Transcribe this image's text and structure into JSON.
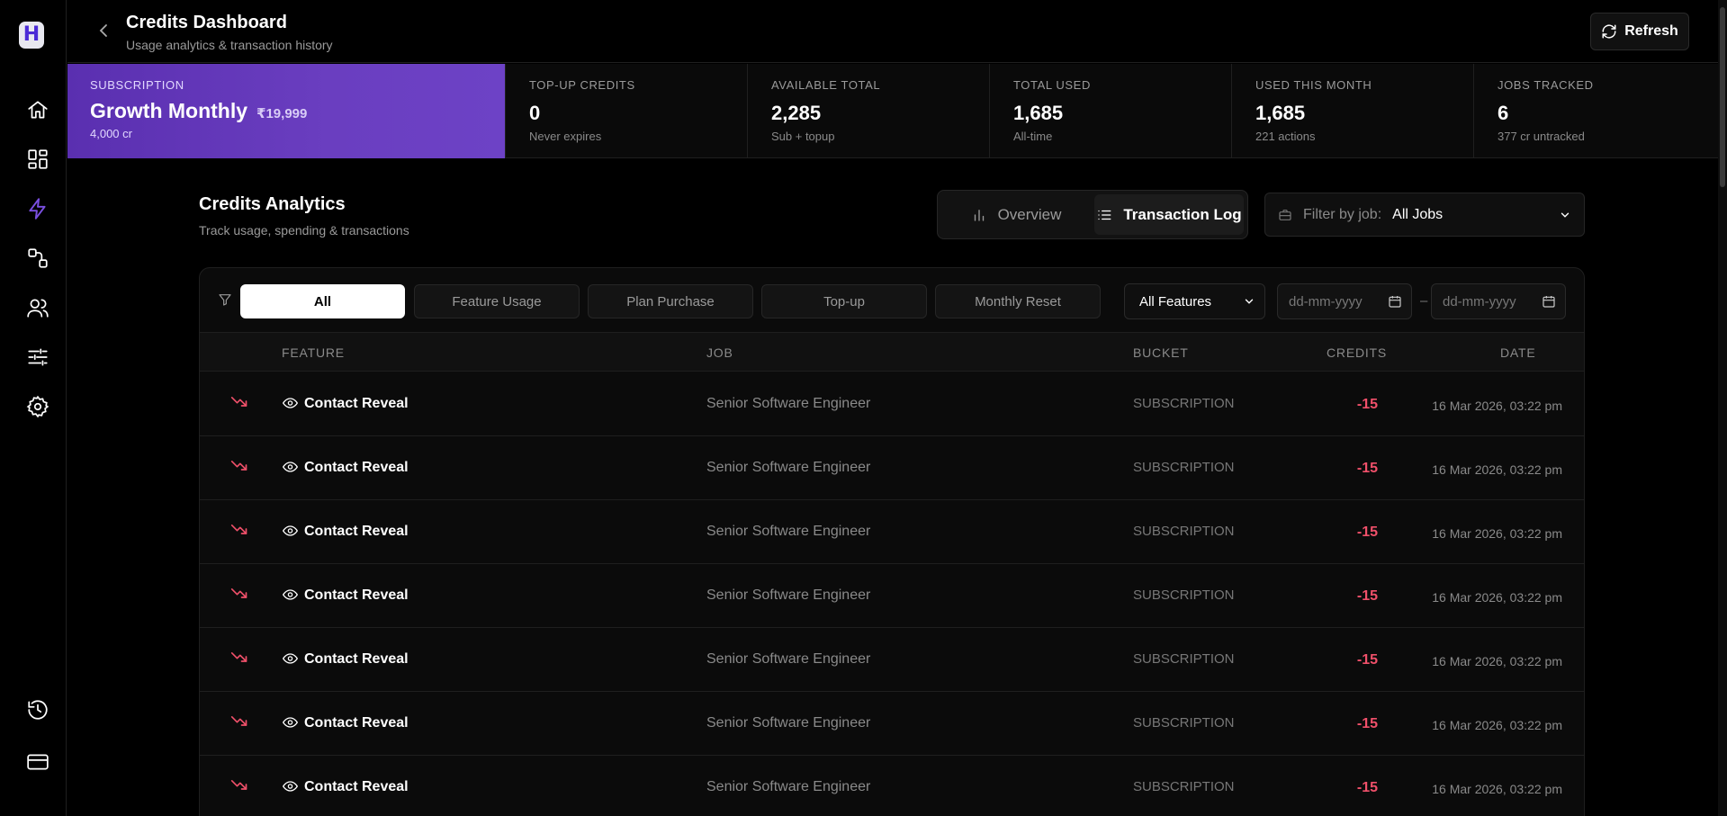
{
  "sidebar": {
    "logo_letter": "H",
    "accent": "#6d42c6",
    "icons": [
      "home-icon",
      "dashboard-icon",
      "credits-bolt-icon",
      "workflow-icon",
      "users-icon",
      "sliders-icon",
      "settings-icon",
      "history-icon",
      "billing-card-icon"
    ],
    "active": "credits-bolt-icon"
  },
  "header": {
    "title": "Credits Dashboard",
    "subtitle": "Usage analytics & transaction history",
    "refresh_label": "Refresh"
  },
  "subscription": {
    "label": "SUBSCRIPTION",
    "plan": "Growth Monthly",
    "price": "₹19,999",
    "credits": "4,000 cr"
  },
  "stats": [
    {
      "label": "TOP-UP CREDITS",
      "value": "0",
      "sub": "Never expires"
    },
    {
      "label": "AVAILABLE TOTAL",
      "value": "2,285",
      "sub": "Sub + topup"
    },
    {
      "label": "TOTAL USED",
      "value": "1,685",
      "sub": "All-time"
    },
    {
      "label": "USED THIS MONTH",
      "value": "1,685",
      "sub": "221 actions"
    },
    {
      "label": "JOBS TRACKED",
      "value": "6",
      "sub": "377 cr untracked"
    }
  ],
  "analytics": {
    "title": "Credits Analytics",
    "subtitle": "Track usage, spending & transactions",
    "tabs": [
      {
        "label": "Overview",
        "icon": "bar-chart-icon",
        "active": false
      },
      {
        "label": "Transaction Log",
        "icon": "list-icon",
        "active": true
      }
    ],
    "job_filter": {
      "label": "Filter by job:",
      "value": "All Jobs"
    }
  },
  "filters": {
    "chips": [
      {
        "label": "All",
        "active": true
      },
      {
        "label": "Feature Usage",
        "active": false
      },
      {
        "label": "Plan Purchase",
        "active": false
      },
      {
        "label": "Top-up",
        "active": false
      },
      {
        "label": "Monthly Reset",
        "active": false
      }
    ],
    "feature_select": "All Features",
    "date_from_placeholder": "dd-mm-yyyy",
    "date_to_placeholder": "dd-mm-yyyy",
    "date_separator": "–"
  },
  "table": {
    "columns": [
      "FEATURE",
      "JOB",
      "BUCKET",
      "CREDITS",
      "DATE"
    ],
    "rows": [
      {
        "feature": "Contact Reveal",
        "job": "Senior Software Engineer",
        "bucket": "SUBSCRIPTION",
        "credits": "-15",
        "date": "16 Mar 2026, 03:22 pm"
      },
      {
        "feature": "Contact Reveal",
        "job": "Senior Software Engineer",
        "bucket": "SUBSCRIPTION",
        "credits": "-15",
        "date": "16 Mar 2026, 03:22 pm"
      },
      {
        "feature": "Contact Reveal",
        "job": "Senior Software Engineer",
        "bucket": "SUBSCRIPTION",
        "credits": "-15",
        "date": "16 Mar 2026, 03:22 pm"
      },
      {
        "feature": "Contact Reveal",
        "job": "Senior Software Engineer",
        "bucket": "SUBSCRIPTION",
        "credits": "-15",
        "date": "16 Mar 2026, 03:22 pm"
      },
      {
        "feature": "Contact Reveal",
        "job": "Senior Software Engineer",
        "bucket": "SUBSCRIPTION",
        "credits": "-15",
        "date": "16 Mar 2026, 03:22 pm"
      },
      {
        "feature": "Contact Reveal",
        "job": "Senior Software Engineer",
        "bucket": "SUBSCRIPTION",
        "credits": "-15",
        "date": "16 Mar 2026, 03:22 pm"
      },
      {
        "feature": "Contact Reveal",
        "job": "Senior Software Engineer",
        "bucket": "SUBSCRIPTION",
        "credits": "-15",
        "date": "16 Mar 2026, 03:22 pm"
      }
    ],
    "negative_color": "#f0506a"
  }
}
